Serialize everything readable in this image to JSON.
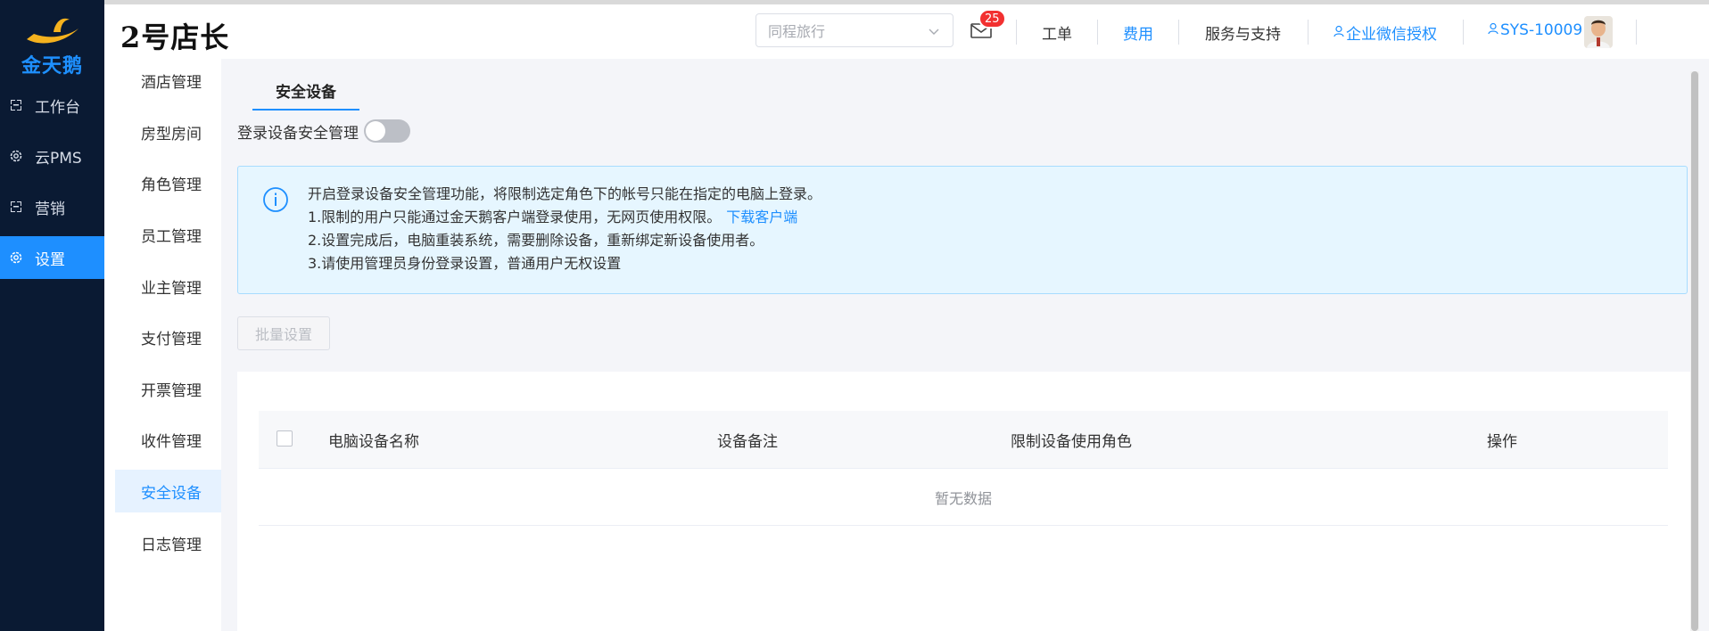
{
  "rail": {
    "logo_text": "金天鹅",
    "items": [
      {
        "label": "工作台",
        "icon": "workbench-icon"
      },
      {
        "label": "云PMS",
        "icon": "gear-icon"
      },
      {
        "label": "营销",
        "icon": "marketing-icon"
      },
      {
        "label": "设置",
        "icon": "gear-icon"
      }
    ],
    "active_index": 3
  },
  "header": {
    "brand": "2号店长",
    "hotel_select_placeholder": "同程旅行",
    "mail_badge": "25",
    "links": {
      "ticket": "工单",
      "fees": "费用",
      "service": "服务与支持",
      "wechat_auth": "企业微信授权",
      "user": "SYS-10009"
    }
  },
  "submenu": {
    "items": [
      "酒店管理",
      "房型房间",
      "角色管理",
      "员工管理",
      "业主管理",
      "支付管理",
      "开票管理",
      "收件管理",
      "安全设备",
      "日志管理"
    ],
    "active_index": 8
  },
  "main": {
    "tab": "安全设备",
    "toggle_label": "登录设备安全管理",
    "toggle_on": false,
    "notice": {
      "line1": "开启登录设备安全管理功能，将限制选定角色下的帐号只能在指定的电脑上登录。",
      "line2": "1.限制的用户只能通过金天鹅客户端登录使用，无网页使用权限。",
      "line2_link": "下载客户端",
      "line3": "2.设置完成后，电脑重装系统，需要删除设备，重新绑定新设备使用者。",
      "line4": "3.请使用管理员身份登录设置，普通用户无权设置"
    },
    "batch_button": "批量设置",
    "table": {
      "columns": [
        "电脑设备名称",
        "设备备注",
        "限制设备使用角色",
        "操作"
      ],
      "empty_text": "暂无数据"
    }
  },
  "colors": {
    "rail_bg": "#0a1a33",
    "accent": "#1e8fff",
    "badge": "#f23030",
    "notice_bg": "#e6f6ff"
  }
}
